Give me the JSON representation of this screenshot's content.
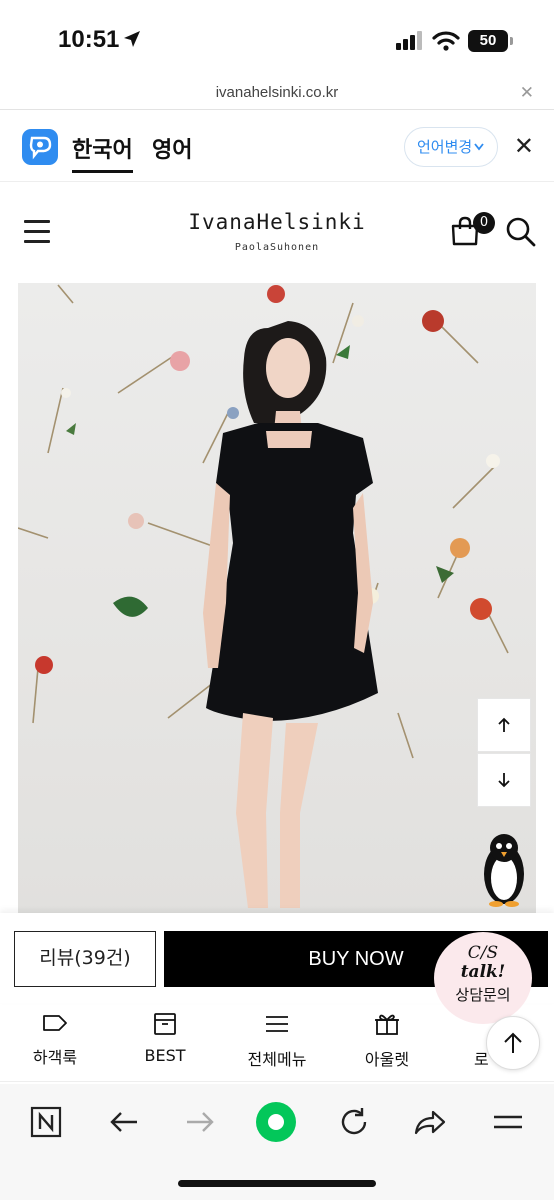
{
  "status_bar": {
    "time": "10:51",
    "battery": "50"
  },
  "url_bar": {
    "url": "ivanahelsinki.co.kr"
  },
  "language_bar": {
    "tabs": [
      "한국어",
      "영어"
    ],
    "active_tab": "한국어",
    "change_label": "언어변경",
    "accent_color": "#2f8cf0"
  },
  "site_header": {
    "brand": "IvanaHelsinki",
    "sub_brand": "PaolaSuhonen",
    "cart_count": "0"
  },
  "product_actions": {
    "review_label": "리뷰(39건)",
    "buy_label": "BUY NOW"
  },
  "cs_talk": {
    "line1": "C/S",
    "line2": "talk!",
    "line3": "상담문의"
  },
  "shop_nav": {
    "items": [
      {
        "label": "하객룩",
        "icon": "tag-icon"
      },
      {
        "label": "BEST",
        "icon": "box-icon"
      },
      {
        "label": "전체메뉴",
        "icon": "menu-icon"
      },
      {
        "label": "아울렛",
        "icon": "gift-icon"
      },
      {
        "label": "로",
        "icon": "login-icon"
      }
    ]
  },
  "browser_toolbar": {
    "icons": [
      "naver-n-icon",
      "back-arrow-icon",
      "forward-arrow-icon",
      "green-home-icon",
      "reload-icon",
      "share-icon",
      "more-menu-icon"
    ],
    "home_color": "#03c75a"
  }
}
